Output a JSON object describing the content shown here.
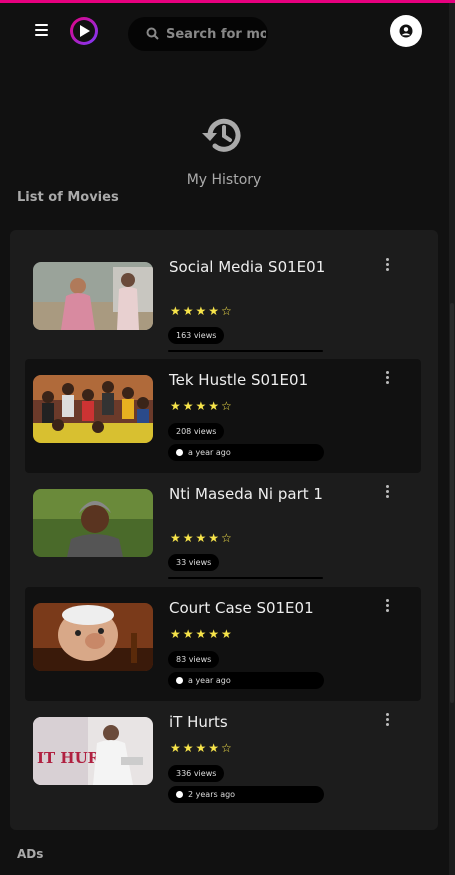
{
  "header": {
    "search_placeholder": "Search for mo"
  },
  "history": {
    "title": "My History",
    "icon": "history-icon"
  },
  "list_title": "List of Movies",
  "movies": [
    {
      "title": "Social Media S01E01",
      "rating": 4,
      "views": "163 views",
      "time": ""
    },
    {
      "title": "Tek Hustle S01E01",
      "rating": 4,
      "views": "208 views",
      "time": "a year ago"
    },
    {
      "title": "Nti Maseda Ni part 1",
      "rating": 4,
      "views": "33 views",
      "time": ""
    },
    {
      "title": "Court Case S01E01",
      "rating": 5,
      "views": "83 views",
      "time": "a year ago"
    },
    {
      "title": "iT Hurts",
      "rating": 4,
      "views": "336 views",
      "time": "2 years ago"
    }
  ],
  "ads_title": "ADs",
  "colors": {
    "accent": "#e6007e",
    "background": "#111111",
    "panel": "#1c1c1c",
    "star": "#f7e44a"
  }
}
